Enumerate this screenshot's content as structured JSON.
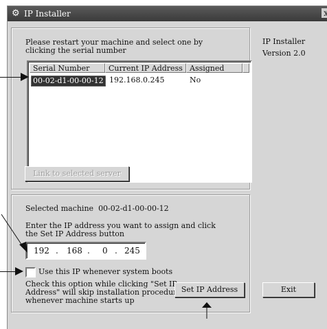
{
  "window": {
    "title": "IP Installer",
    "close_glyph": "x"
  },
  "side": {
    "product": "IP Installer",
    "version": "Version 2.0"
  },
  "servers": {
    "instruction": "Please restart your machine and select one by\nclicking the serial number",
    "columns": [
      "Serial Number",
      "Current IP Address",
      "Assigned"
    ],
    "rows": [
      {
        "serial": "00-02-d1-00-00-12",
        "ip": "192.168.0.245",
        "assigned": "No",
        "selected": true
      }
    ],
    "link_button": "Link to selected server"
  },
  "assign": {
    "selected_label": "Selected machine",
    "selected_serial": "00-02-d1-00-00-12",
    "instruction": "Enter the IP address you want to assign and click\nthe Set IP Address button",
    "ip_octets": [
      "192",
      "168",
      "0",
      "245"
    ],
    "checkbox_label": "Use this IP whenever system boots",
    "checkbox_checked": false,
    "checkbox_help": "Check this option while clicking \"Set IP\nAddress\" will skip installation procedure\nwhenever machine starts up",
    "set_button": "Set IP Address"
  },
  "exit_button": "Exit",
  "colors": {
    "window_bg": "#d6d6d6",
    "titlebar": "#3a3a3a",
    "selection": "#333333"
  }
}
